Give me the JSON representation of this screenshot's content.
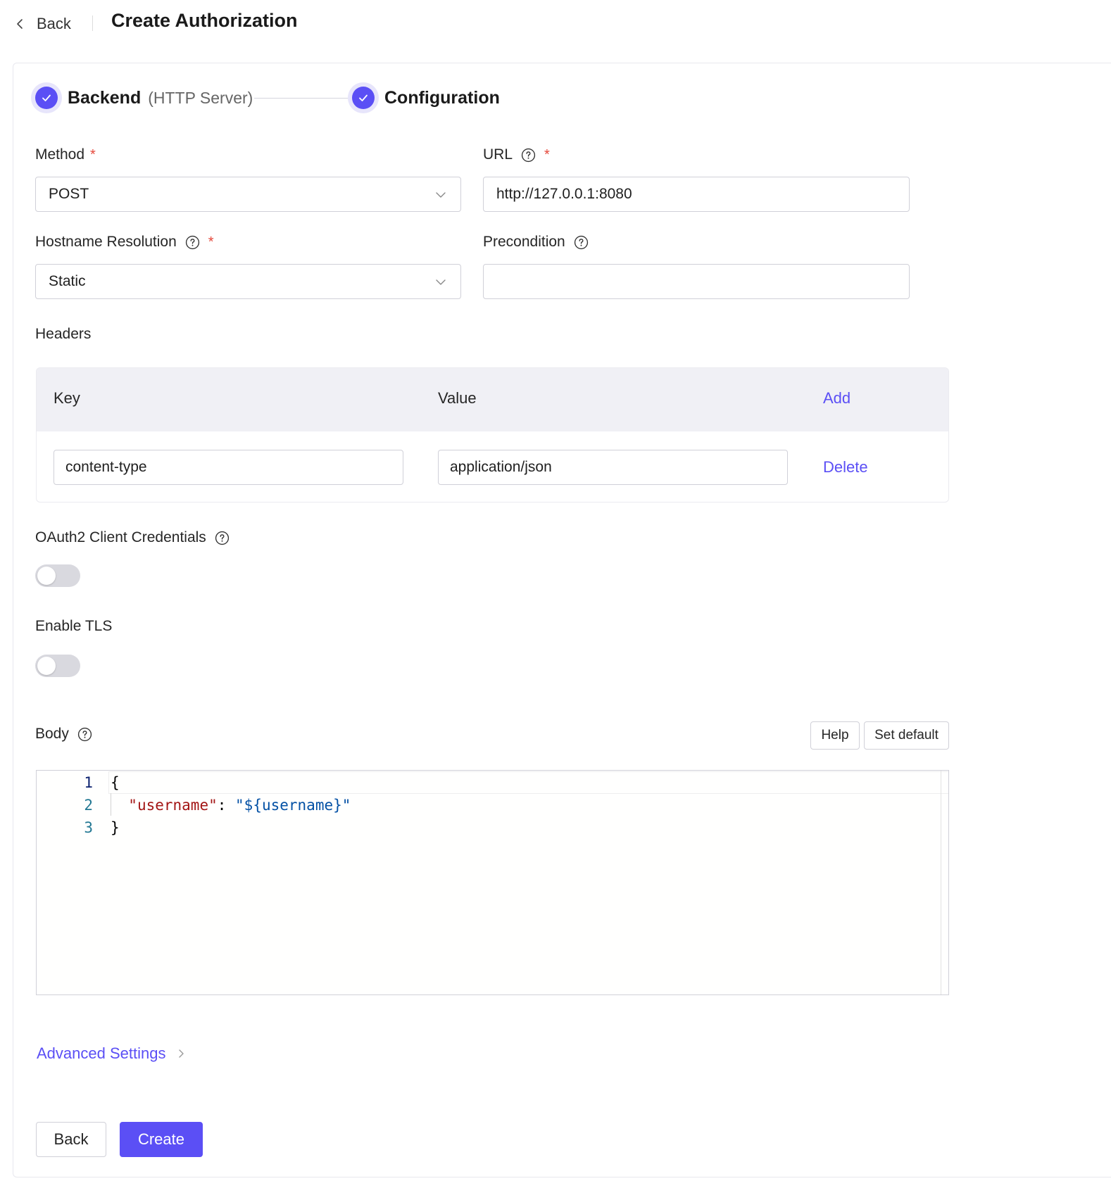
{
  "header": {
    "back_label": "Back",
    "title": "Create Authorization"
  },
  "steps": [
    {
      "title": "Backend",
      "subtitle": "(HTTP Server)",
      "status": "done"
    },
    {
      "title": "Configuration",
      "subtitle": "",
      "status": "done"
    }
  ],
  "form": {
    "method": {
      "label": "Method",
      "required": "*",
      "value": "POST"
    },
    "url": {
      "label": "URL",
      "required": "*",
      "value": "http://127.0.0.1:8080"
    },
    "hostname_resolution": {
      "label": "Hostname Resolution",
      "required": "*",
      "value": "Static"
    },
    "precondition": {
      "label": "Precondition",
      "value": ""
    },
    "headers": {
      "label": "Headers",
      "key_header": "Key",
      "value_header": "Value",
      "add_label": "Add",
      "rows": [
        {
          "key": "content-type",
          "value": "application/json",
          "delete_label": "Delete"
        }
      ]
    },
    "oauth2": {
      "label": "OAuth2 Client Credentials",
      "enabled": false
    },
    "tls": {
      "label": "Enable TLS",
      "enabled": false
    },
    "body": {
      "label": "Body",
      "help_button": "Help",
      "set_default_button": "Set default",
      "line_numbers": [
        "1",
        "2",
        "3"
      ],
      "lines": {
        "line1": "{",
        "line2_key": "\"username\"",
        "line2_sep": ": ",
        "line2_value": "\"${username}\"",
        "line3": "}"
      }
    }
  },
  "advanced_settings_label": "Advanced Settings",
  "footer": {
    "back_label": "Back",
    "create_label": "Create"
  },
  "colors": {
    "primary": "#5b4ff5",
    "required": "#e5483b",
    "json_key": "#a31515",
    "json_string": "#0451a5"
  }
}
